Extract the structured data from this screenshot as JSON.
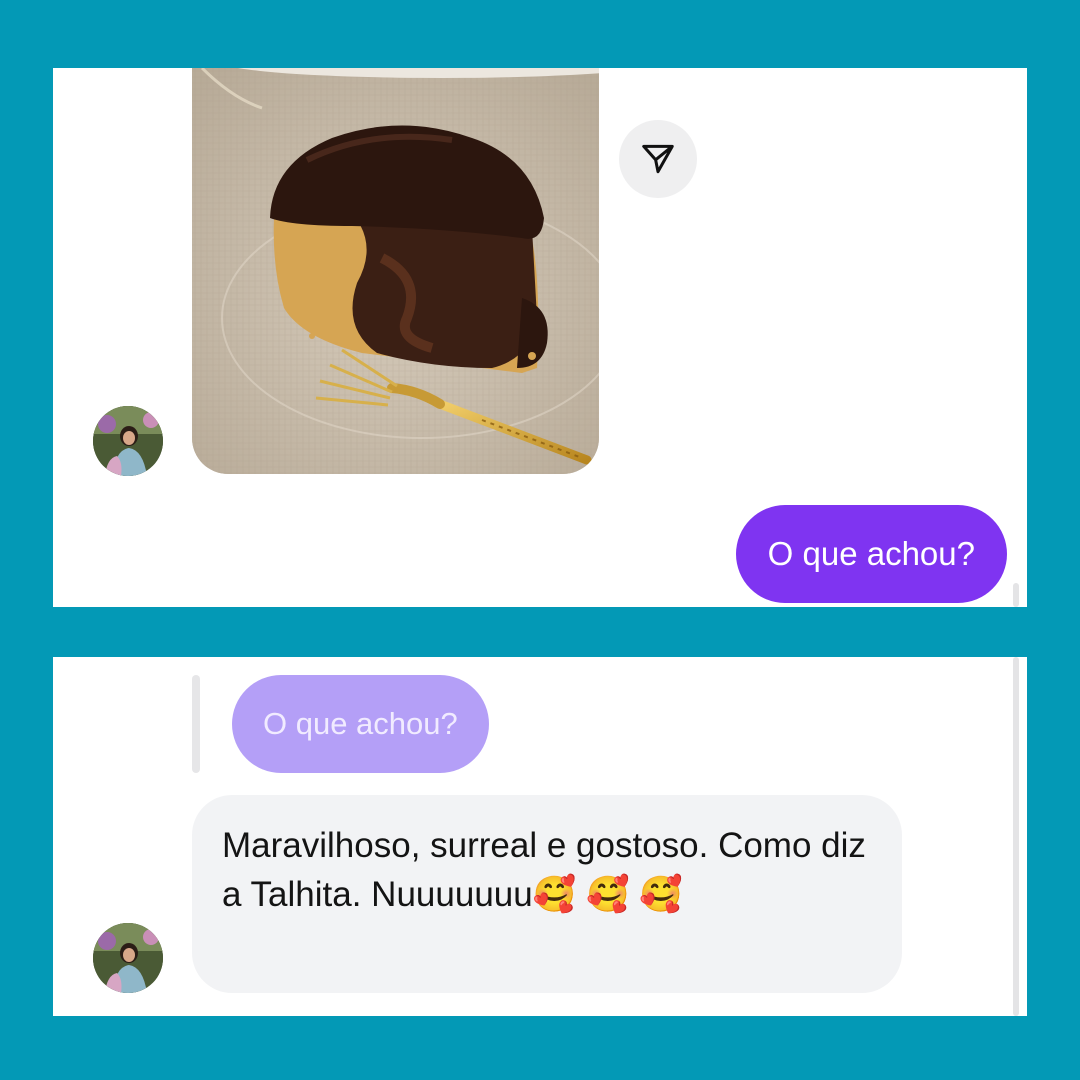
{
  "conversation": {
    "top": {
      "shared_photo": {
        "subject": "slice of marble cake with chocolate frosting and a gold fork"
      },
      "share_button": {
        "icon": "send-icon"
      },
      "sent_message": {
        "text": "O que achou?",
        "color": "#7f34f1"
      }
    },
    "bottom": {
      "quoted_reply": {
        "text": "O que achou?",
        "color": "#b49ff7"
      },
      "received_message": {
        "text": "Maravilhoso, surreal e gostoso. Como diz a Talhita. Nuuuuuuu🥰 🥰 🥰",
        "color": "#f2f3f5"
      }
    }
  },
  "colors": {
    "frame_background": "#0399b6",
    "panel": "#ffffff"
  }
}
